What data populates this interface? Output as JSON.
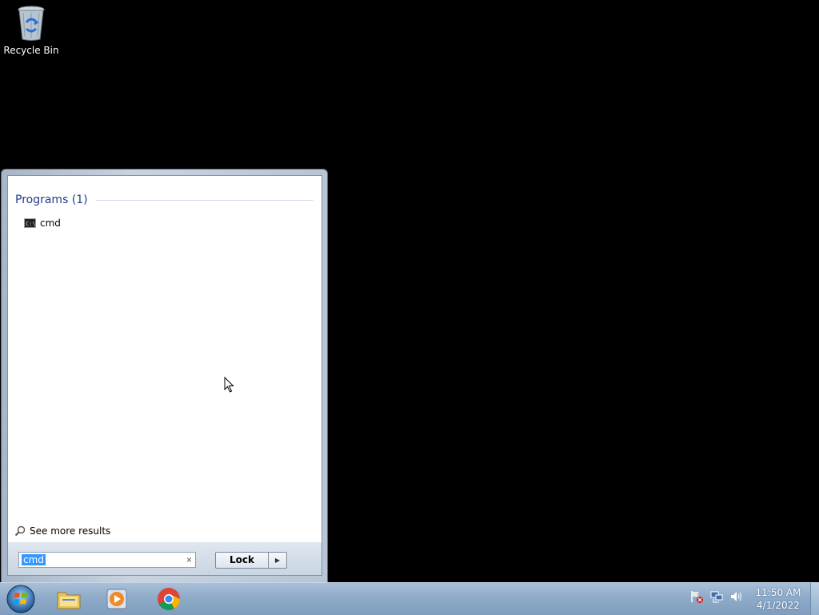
{
  "desktop": {
    "icons": [
      {
        "label": "Recycle Bin",
        "icon": "recycle-bin-icon"
      }
    ]
  },
  "start_menu": {
    "group_header": "Programs (1)",
    "results": [
      {
        "label": "cmd",
        "icon": "command-prompt-icon"
      }
    ],
    "see_more": "See more results",
    "search": {
      "value": "cmd",
      "clear_glyph": "×"
    },
    "power_button": {
      "label": "Lock",
      "arrow": "▶"
    }
  },
  "taskbar": {
    "pinned": [
      {
        "name": "windows-explorer",
        "icon": "folder-icon"
      },
      {
        "name": "windows-media-player",
        "icon": "media-player-icon"
      },
      {
        "name": "google-chrome",
        "icon": "chrome-icon"
      }
    ],
    "clock": {
      "time": "11:50 AM",
      "date": "4/1/2022"
    }
  },
  "colors": {
    "desktop": "#000000",
    "selection": "#3399ff",
    "group_header_text": "#1e3c8c",
    "taskbar": "#8fabc9"
  }
}
